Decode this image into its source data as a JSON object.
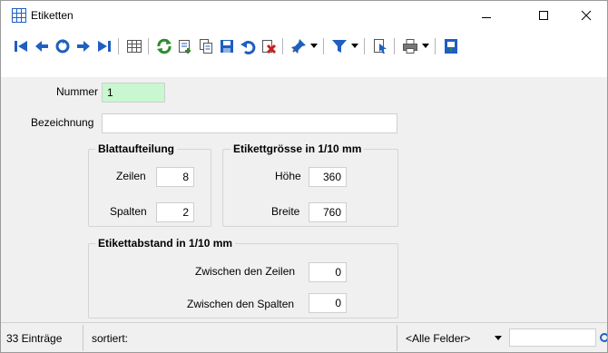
{
  "window": {
    "title": "Etiketten",
    "controls": {
      "minimize": "—",
      "maximize": "☐",
      "close": "✕"
    }
  },
  "toolbar": {
    "icons": [
      "first-record-icon",
      "previous-record-icon",
      "search-record-icon",
      "next-record-icon",
      "last-record-icon",
      "table-view-icon",
      "refresh-icon",
      "new-record-icon",
      "copy-record-icon",
      "save-icon",
      "undo-icon",
      "delete-icon",
      "pin-icon",
      "filter-icon",
      "cursor-select-icon",
      "print-icon",
      "exit-icon"
    ],
    "colors": {
      "blue": "#1f5fbf",
      "green": "#2e8b2e",
      "red": "#c81e1e"
    }
  },
  "form": {
    "nummer": {
      "label": "Nummer",
      "value": "1"
    },
    "bezeichnung": {
      "label": "Bezeichnung",
      "value": ""
    },
    "blattaufteilung": {
      "title": "Blattaufteilung",
      "zeilen": {
        "label": "Zeilen",
        "value": "8"
      },
      "spalten": {
        "label": "Spalten",
        "value": "2"
      }
    },
    "etikettgroesse": {
      "title": "Etikettgrösse in 1/10 mm",
      "hoehe": {
        "label": "Höhe",
        "value": "360"
      },
      "breite": {
        "label": "Breite",
        "value": "760"
      }
    },
    "etikettabstand": {
      "title": "Etikettabstand in 1/10 mm",
      "zwischen_zeilen": {
        "label": "Zwischen den Zeilen",
        "value": "0"
      },
      "zwischen_spalten": {
        "label": "Zwischen den Spalten",
        "value": "0"
      }
    }
  },
  "statusbar": {
    "entries": "33 Einträge",
    "sort": "sortiert:",
    "field_selector": "<Alle Felder>",
    "search_value": ""
  }
}
